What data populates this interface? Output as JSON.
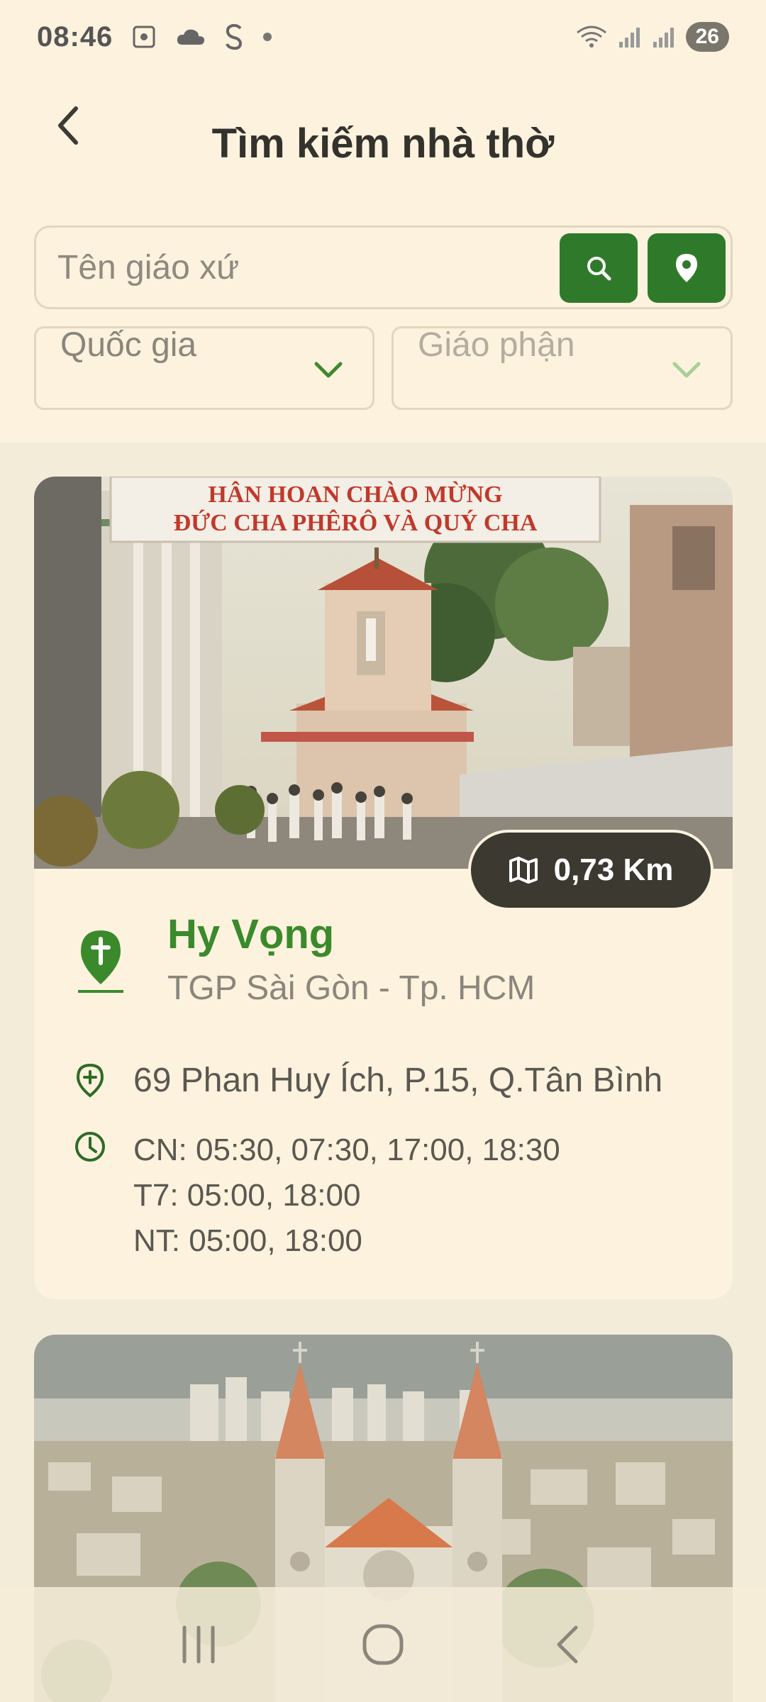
{
  "status_bar": {
    "time": "08:46",
    "battery": "26"
  },
  "header": {
    "title": "Tìm kiếm nhà thờ"
  },
  "search": {
    "placeholder": "Tên giáo xứ",
    "search_icon": "search-icon",
    "locate_icon": "location-pin-icon"
  },
  "filters": {
    "country_label": "Quốc gia",
    "diocese_label": "Giáo phận"
  },
  "results": [
    {
      "banner_text_line1": "HÂN HOAN CHÀO MỪNG",
      "banner_text_line2": "ĐỨC CHA PHÊRÔ VÀ QUÝ CHA",
      "distance": "0,73 Km",
      "name": "Hy Vọng",
      "diocese": "TGP Sài Gòn - Tp. HCM",
      "address": "69 Phan Huy Ích, P.15, Q.Tân Bình",
      "schedule": [
        "CN: 05:30, 07:30, 17:00, 18:30",
        "T7: 05:00, 18:00",
        "NT: 05:00, 18:00"
      ]
    }
  ],
  "colors": {
    "primary_green": "#2e7a2a",
    "name_green": "#3a8a2c",
    "background": "#fcf2de",
    "pill_dark": "#3b3930"
  }
}
